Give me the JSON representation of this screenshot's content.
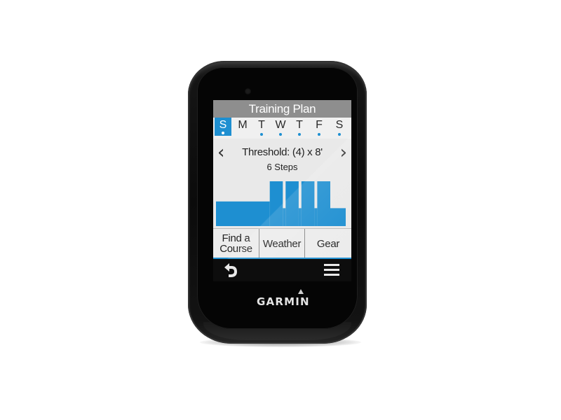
{
  "device": {
    "brand": "GARMIN"
  },
  "screen": {
    "title": "Training Plan",
    "days": [
      {
        "label": "S",
        "selected": true,
        "has_workout": true
      },
      {
        "label": "M",
        "selected": false,
        "has_workout": false
      },
      {
        "label": "T",
        "selected": false,
        "has_workout": true
      },
      {
        "label": "W",
        "selected": false,
        "has_workout": true
      },
      {
        "label": "T",
        "selected": false,
        "has_workout": true
      },
      {
        "label": "F",
        "selected": false,
        "has_workout": true
      },
      {
        "label": "S",
        "selected": false,
        "has_workout": true
      }
    ],
    "workout": {
      "name": "Threshold: (4) x 8'",
      "steps": "6 Steps",
      "prev_icon": "chevron-left-icon",
      "next_icon": "chevron-right-icon",
      "profile_color": "#1e8fd1",
      "profile_steps": [
        {
          "type": "warmup",
          "relative_duration": 0.34,
          "relative_intensity": 0.55
        },
        {
          "type": "interval",
          "relative_duration": 0.1,
          "relative_intensity": 1.0
        },
        {
          "type": "interval",
          "relative_duration": 0.1,
          "relative_intensity": 1.0
        },
        {
          "type": "interval",
          "relative_duration": 0.1,
          "relative_intensity": 1.0
        },
        {
          "type": "interval",
          "relative_duration": 0.1,
          "relative_intensity": 1.0
        },
        {
          "type": "cooldown",
          "relative_duration": 0.08,
          "relative_intensity": 0.4
        }
      ]
    },
    "buttons": [
      {
        "label_line1": "Find a",
        "label_line2": "Course"
      },
      {
        "label_line1": "Weather",
        "label_line2": ""
      },
      {
        "label_line1": "Gear",
        "label_line2": ""
      }
    ],
    "accent_color": "#1e8fd1"
  },
  "softkeys": {
    "back_icon": "back-arrow-icon",
    "menu_icon": "hamburger-menu-icon"
  }
}
